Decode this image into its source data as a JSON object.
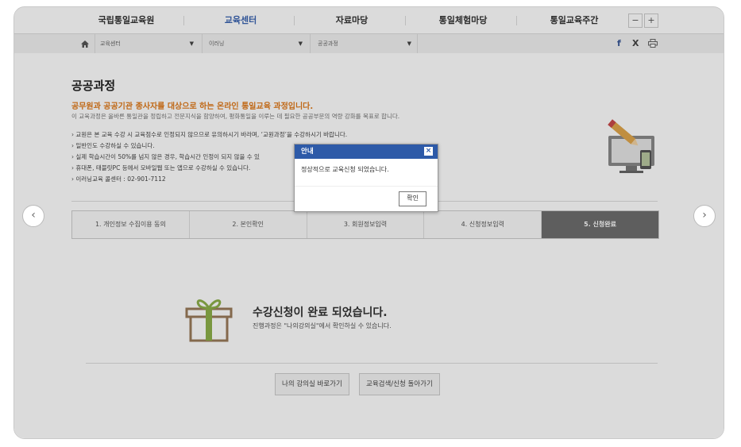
{
  "topnav": {
    "items": [
      "국립통일교육원",
      "교육센터",
      "자료마당",
      "통일체험마당",
      "통일교육주간"
    ],
    "zoom_minus": "−",
    "zoom_plus": "+"
  },
  "breadcrumb": {
    "dropdowns": [
      "교육센터",
      "이러닝",
      "공공과정"
    ],
    "social": {
      "facebook": "f",
      "x": "X"
    }
  },
  "page": {
    "title": "공공과정",
    "subtitle": "공무원과 공공기관 종사자를 대상으로 하는 온라인 통일교육 과정입니다.",
    "description": "이 교육과정은 올바른 통일관을 정립하고 전문지식을 함양하여, 평화통일을 이루는 데 필요한 공공부문의 역량 강화를 목표로 합니다.",
    "bullets": [
      "› 교원은 본 교육 수강 시 교육점수로 인정되지 않으므로 유의하시기 바라며, ‘교원과정’을 수강하시기 바랍니다.",
      "› 일반인도 수강하실 수 있습니다.",
      "› 실제 학습시간이 50%를 넘지 않은 경우, 학습시간 인정이 되지 않을 수 있",
      "› 휴대폰, 태블릿PC 등에서 모바일웹 또는 앱으로 수강하실 수 있습니다.",
      "› 이러닝교육 콜센터 : 02-901-7112"
    ]
  },
  "steps": [
    "1. 개인정보 수집이용 동의",
    "2. 본인확인",
    "3. 회원정보입력",
    "4. 신청정보입력",
    "5. 신청완료"
  ],
  "completion": {
    "title": "수강신청이 완료 되었습니다.",
    "subtitle": "진행과정은 \"나의강의실\"에서 확인하실 수 있습니다."
  },
  "buttons": {
    "my_classroom": "나의 강의실 바로가기",
    "back_to_search": "교육검색/신청 돌아가기"
  },
  "modal": {
    "title": "안내",
    "close": "×",
    "message": "정상적으로 교육신청 되었습니다.",
    "ok": "확인"
  },
  "nav_arrows": {
    "prev": "‹",
    "next": "›"
  },
  "colors": {
    "accent_orange": "#e07a1a",
    "modal_header": "#2d5aa8",
    "active_step": "#6e6e6e"
  }
}
